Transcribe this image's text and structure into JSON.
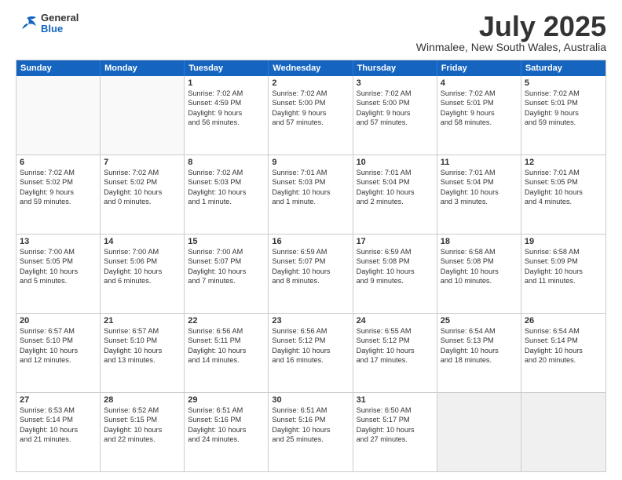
{
  "header": {
    "logo_general": "General",
    "logo_blue": "Blue",
    "title": "July 2025",
    "location": "Winmalee, New South Wales, Australia"
  },
  "days_of_week": [
    "Sunday",
    "Monday",
    "Tuesday",
    "Wednesday",
    "Thursday",
    "Friday",
    "Saturday"
  ],
  "weeks": [
    [
      {
        "day": "",
        "data": [],
        "empty": true
      },
      {
        "day": "",
        "data": [],
        "empty": true
      },
      {
        "day": "1",
        "data": [
          "Sunrise: 7:02 AM",
          "Sunset: 4:59 PM",
          "Daylight: 9 hours",
          "and 56 minutes."
        ]
      },
      {
        "day": "2",
        "data": [
          "Sunrise: 7:02 AM",
          "Sunset: 5:00 PM",
          "Daylight: 9 hours",
          "and 57 minutes."
        ]
      },
      {
        "day": "3",
        "data": [
          "Sunrise: 7:02 AM",
          "Sunset: 5:00 PM",
          "Daylight: 9 hours",
          "and 57 minutes."
        ]
      },
      {
        "day": "4",
        "data": [
          "Sunrise: 7:02 AM",
          "Sunset: 5:01 PM",
          "Daylight: 9 hours",
          "and 58 minutes."
        ]
      },
      {
        "day": "5",
        "data": [
          "Sunrise: 7:02 AM",
          "Sunset: 5:01 PM",
          "Daylight: 9 hours",
          "and 59 minutes."
        ]
      }
    ],
    [
      {
        "day": "6",
        "data": [
          "Sunrise: 7:02 AM",
          "Sunset: 5:02 PM",
          "Daylight: 9 hours",
          "and 59 minutes."
        ]
      },
      {
        "day": "7",
        "data": [
          "Sunrise: 7:02 AM",
          "Sunset: 5:02 PM",
          "Daylight: 10 hours",
          "and 0 minutes."
        ]
      },
      {
        "day": "8",
        "data": [
          "Sunrise: 7:02 AM",
          "Sunset: 5:03 PM",
          "Daylight: 10 hours",
          "and 1 minute."
        ]
      },
      {
        "day": "9",
        "data": [
          "Sunrise: 7:01 AM",
          "Sunset: 5:03 PM",
          "Daylight: 10 hours",
          "and 1 minute."
        ]
      },
      {
        "day": "10",
        "data": [
          "Sunrise: 7:01 AM",
          "Sunset: 5:04 PM",
          "Daylight: 10 hours",
          "and 2 minutes."
        ]
      },
      {
        "day": "11",
        "data": [
          "Sunrise: 7:01 AM",
          "Sunset: 5:04 PM",
          "Daylight: 10 hours",
          "and 3 minutes."
        ]
      },
      {
        "day": "12",
        "data": [
          "Sunrise: 7:01 AM",
          "Sunset: 5:05 PM",
          "Daylight: 10 hours",
          "and 4 minutes."
        ]
      }
    ],
    [
      {
        "day": "13",
        "data": [
          "Sunrise: 7:00 AM",
          "Sunset: 5:05 PM",
          "Daylight: 10 hours",
          "and 5 minutes."
        ]
      },
      {
        "day": "14",
        "data": [
          "Sunrise: 7:00 AM",
          "Sunset: 5:06 PM",
          "Daylight: 10 hours",
          "and 6 minutes."
        ]
      },
      {
        "day": "15",
        "data": [
          "Sunrise: 7:00 AM",
          "Sunset: 5:07 PM",
          "Daylight: 10 hours",
          "and 7 minutes."
        ]
      },
      {
        "day": "16",
        "data": [
          "Sunrise: 6:59 AM",
          "Sunset: 5:07 PM",
          "Daylight: 10 hours",
          "and 8 minutes."
        ]
      },
      {
        "day": "17",
        "data": [
          "Sunrise: 6:59 AM",
          "Sunset: 5:08 PM",
          "Daylight: 10 hours",
          "and 9 minutes."
        ]
      },
      {
        "day": "18",
        "data": [
          "Sunrise: 6:58 AM",
          "Sunset: 5:08 PM",
          "Daylight: 10 hours",
          "and 10 minutes."
        ]
      },
      {
        "day": "19",
        "data": [
          "Sunrise: 6:58 AM",
          "Sunset: 5:09 PM",
          "Daylight: 10 hours",
          "and 11 minutes."
        ]
      }
    ],
    [
      {
        "day": "20",
        "data": [
          "Sunrise: 6:57 AM",
          "Sunset: 5:10 PM",
          "Daylight: 10 hours",
          "and 12 minutes."
        ]
      },
      {
        "day": "21",
        "data": [
          "Sunrise: 6:57 AM",
          "Sunset: 5:10 PM",
          "Daylight: 10 hours",
          "and 13 minutes."
        ]
      },
      {
        "day": "22",
        "data": [
          "Sunrise: 6:56 AM",
          "Sunset: 5:11 PM",
          "Daylight: 10 hours",
          "and 14 minutes."
        ]
      },
      {
        "day": "23",
        "data": [
          "Sunrise: 6:56 AM",
          "Sunset: 5:12 PM",
          "Daylight: 10 hours",
          "and 16 minutes."
        ]
      },
      {
        "day": "24",
        "data": [
          "Sunrise: 6:55 AM",
          "Sunset: 5:12 PM",
          "Daylight: 10 hours",
          "and 17 minutes."
        ]
      },
      {
        "day": "25",
        "data": [
          "Sunrise: 6:54 AM",
          "Sunset: 5:13 PM",
          "Daylight: 10 hours",
          "and 18 minutes."
        ]
      },
      {
        "day": "26",
        "data": [
          "Sunrise: 6:54 AM",
          "Sunset: 5:14 PM",
          "Daylight: 10 hours",
          "and 20 minutes."
        ]
      }
    ],
    [
      {
        "day": "27",
        "data": [
          "Sunrise: 6:53 AM",
          "Sunset: 5:14 PM",
          "Daylight: 10 hours",
          "and 21 minutes."
        ]
      },
      {
        "day": "28",
        "data": [
          "Sunrise: 6:52 AM",
          "Sunset: 5:15 PM",
          "Daylight: 10 hours",
          "and 22 minutes."
        ]
      },
      {
        "day": "29",
        "data": [
          "Sunrise: 6:51 AM",
          "Sunset: 5:16 PM",
          "Daylight: 10 hours",
          "and 24 minutes."
        ]
      },
      {
        "day": "30",
        "data": [
          "Sunrise: 6:51 AM",
          "Sunset: 5:16 PM",
          "Daylight: 10 hours",
          "and 25 minutes."
        ]
      },
      {
        "day": "31",
        "data": [
          "Sunrise: 6:50 AM",
          "Sunset: 5:17 PM",
          "Daylight: 10 hours",
          "and 27 minutes."
        ]
      },
      {
        "day": "",
        "data": [],
        "empty": true,
        "shaded": true
      },
      {
        "day": "",
        "data": [],
        "empty": true,
        "shaded": true
      }
    ]
  ]
}
